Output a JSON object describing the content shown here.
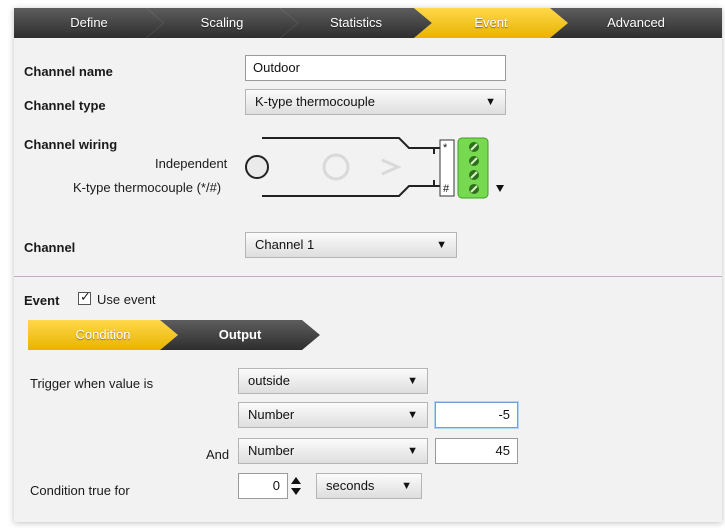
{
  "wizard": {
    "steps": [
      {
        "label": "Define"
      },
      {
        "label": "Scaling"
      },
      {
        "label": "Statistics"
      },
      {
        "label": "Event"
      },
      {
        "label": "Advanced"
      }
    ],
    "active_index": 3
  },
  "channel": {
    "name_label": "Channel name",
    "name_value": "Outdoor",
    "type_label": "Channel type",
    "type_value": "K-type thermocouple",
    "wiring_label": "Channel wiring",
    "wiring_independent": "Independent",
    "wiring_sensor": "K-type thermocouple (*/#)",
    "wiring_pin_top": "*",
    "wiring_pin_bottom": "#",
    "channel_label": "Channel",
    "channel_value": "Channel 1"
  },
  "event": {
    "label": "Event",
    "use_event_label": "Use event",
    "use_event_checked": true,
    "tabs": [
      {
        "label": "Condition"
      },
      {
        "label": "Output"
      }
    ],
    "trigger_label": "Trigger when value is",
    "trigger_value": "outside",
    "first_type": "Number",
    "first_value": "-5",
    "and_label": "And",
    "second_type": "Number",
    "second_value": "45",
    "duration_label": "Condition true for",
    "duration_value": "0",
    "duration_unit": "seconds"
  },
  "colors": {
    "accent_yellow": "#f2c40f",
    "dark_step": "#3a3a3a",
    "terminal_green": "#6fd64a"
  }
}
